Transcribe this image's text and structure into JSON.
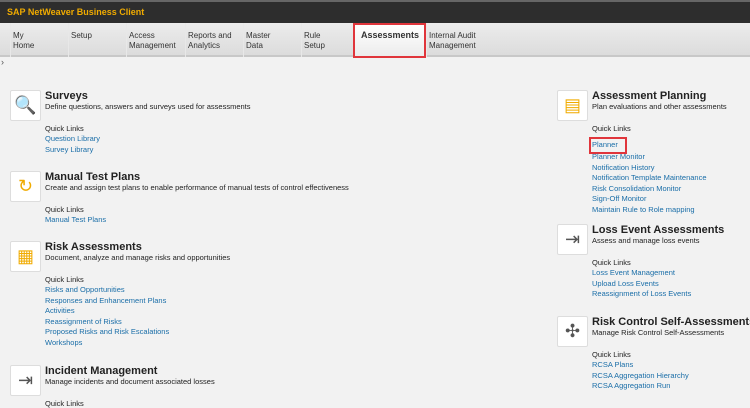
{
  "app_title": "SAP NetWeaver Business Client",
  "tabs": [
    "My\nHome",
    "Setup",
    "Access\nManagement",
    "Reports and\nAnalytics",
    "Master\nData",
    "Rule\nSetup",
    "Assessments",
    "Internal Audit\nManagement"
  ],
  "quick_links_label": "Quick Links",
  "left": [
    {
      "title": "Surveys",
      "desc": "Define questions, answers and surveys used for assessments",
      "icon": "survey-icon",
      "links": [
        "Question Library",
        "Survey Library"
      ]
    },
    {
      "title": "Manual Test Plans",
      "desc": "Create and assign test plans to enable performance of manual tests of control effectiveness",
      "icon": "test-plan-icon",
      "links": [
        "Manual Test Plans"
      ]
    },
    {
      "title": "Risk Assessments",
      "desc": "Document, analyze and manage risks and opportunities",
      "icon": "risk-icon",
      "links": [
        "Risks and Opportunities",
        "Responses and Enhancement Plans",
        "Activities",
        "Reassignment of Risks",
        "Proposed Risks and Risk Escalations",
        "Workshops"
      ]
    },
    {
      "title": "Incident Management",
      "desc": "Manage incidents and document associated losses",
      "icon": "incident-icon",
      "links": []
    }
  ],
  "right": [
    {
      "title": "Assessment Planning",
      "desc": "Plan evaluations and other assessments",
      "icon": "calendar-icon",
      "links": [
        "Planner",
        "Planner Monitor",
        "Notification History",
        "Notification Template Maintenance",
        "Risk Consolidation Monitor",
        "Sign-Off Monitor",
        "Maintain Rule to Role mapping"
      ]
    },
    {
      "title": "Loss Event Assessments",
      "desc": "Assess and manage loss events",
      "icon": "loss-event-icon",
      "links": [
        "Loss Event Management",
        "Upload Loss Events",
        "Reassignment of Loss Events"
      ]
    },
    {
      "title": "Risk Control Self-Assessments",
      "desc": "Manage Risk Control Self-Assessments",
      "icon": "rcsa-icon",
      "links": [
        "RCSA Plans",
        "RCSA Aggregation Hierarchy",
        "RCSA Aggregation Run"
      ]
    }
  ]
}
